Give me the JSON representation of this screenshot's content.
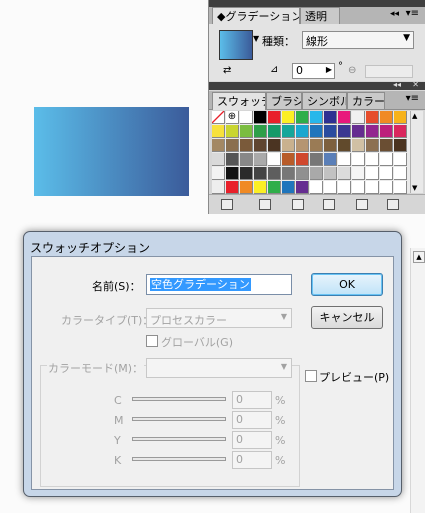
{
  "gradient_panel": {
    "tab_label": "◆グラデーション",
    "tab2_label": "透明",
    "type_label": "種類：",
    "type_value": "線形",
    "angle_value": "0",
    "degree_symbol": "°"
  },
  "swatches_panel": {
    "tabs": [
      "スウォッチ",
      "ブラシ",
      "シンボル",
      "カラー"
    ]
  },
  "dialog": {
    "title": "スウォッチオプション",
    "name_label": "名前(S)：",
    "name_value": "空色グラデーション",
    "colortype_label": "カラータイプ(T)：",
    "colortype_value": "プロセスカラー",
    "global_label": "グローバル(G)",
    "colormode_label": "カラーモード(M)：",
    "ok_label": "OK",
    "cancel_label": "キャンセル",
    "preview_label": "プレビュー(P)",
    "channels": [
      {
        "label": "C",
        "value": "0",
        "unit": "%"
      },
      {
        "label": "M",
        "value": "0",
        "unit": "%"
      },
      {
        "label": "Y",
        "value": "0",
        "unit": "%"
      },
      {
        "label": "K",
        "value": "0",
        "unit": "%"
      }
    ]
  },
  "colors": {
    "gradient_start": "#5bbde9",
    "gradient_end": "#3b5b9a",
    "selection": "#3399ff"
  }
}
